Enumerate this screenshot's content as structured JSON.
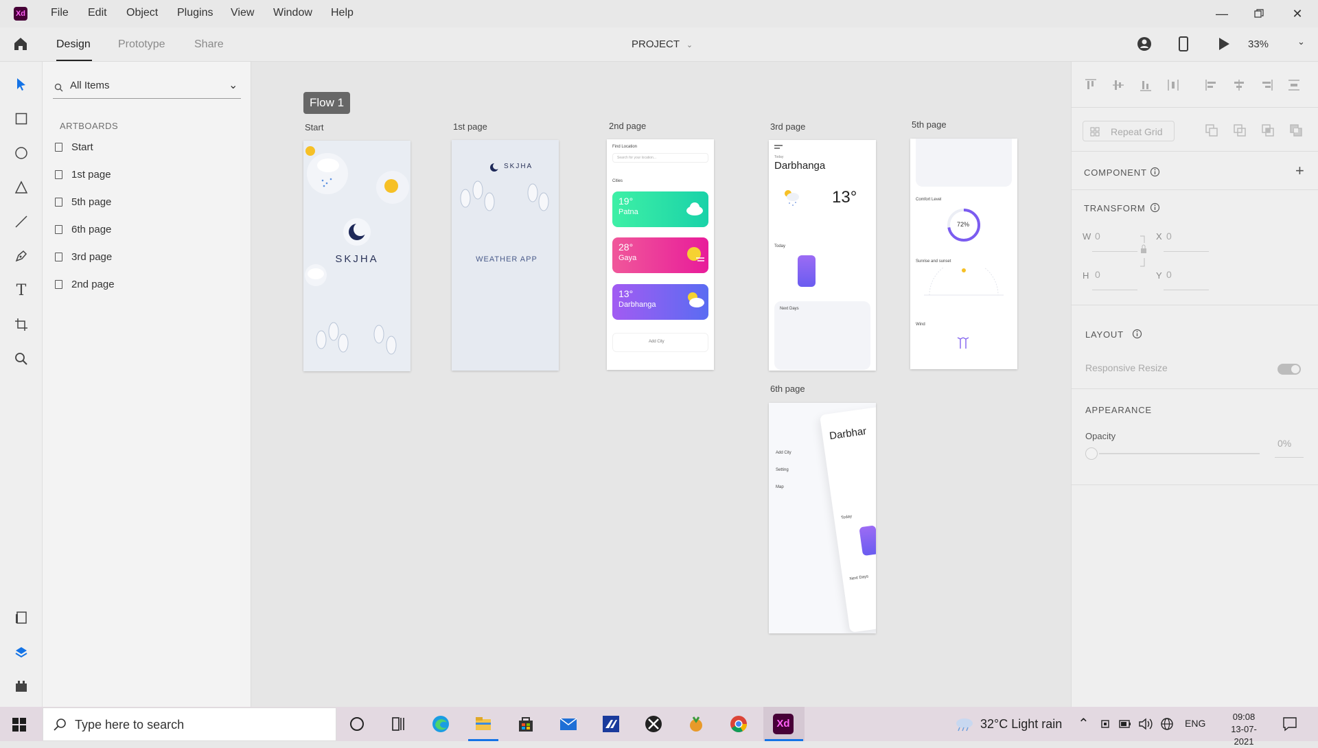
{
  "app": {
    "logo_text": "Xd"
  },
  "menu": [
    "File",
    "Edit",
    "Object",
    "Plugins",
    "View",
    "Window",
    "Help"
  ],
  "modes": {
    "tabs": [
      "Design",
      "Prototype",
      "Share"
    ],
    "active": "Design"
  },
  "document": {
    "title": "PROJECT",
    "zoom": "33%"
  },
  "layers_panel": {
    "search_label": "All Items",
    "section_heading": "ARTBOARDS",
    "items": [
      "Start",
      "1st page",
      "5th page",
      "6th page",
      "3rd page",
      "2nd page"
    ]
  },
  "canvas": {
    "flow_label": "Flow 1",
    "artboard_titles": [
      "Start",
      "1st page",
      "2nd page",
      "3rd page",
      "5th page",
      "6th page"
    ],
    "start": {
      "brand": "SKJHA"
    },
    "page1": {
      "brand": "SKJHA",
      "subtitle": "WEATHER APP"
    },
    "page2": {
      "heading": "Find Location",
      "search_placeholder": "Search for your location...",
      "section": "Cities",
      "cards": [
        {
          "temp": "19°",
          "city": "Patna"
        },
        {
          "temp": "28°",
          "city": "Gaya"
        },
        {
          "temp": "13°",
          "city": "Darbhanga"
        }
      ],
      "add_label": "Add City"
    },
    "page3": {
      "day": "Today",
      "city": "Darbhanga",
      "temp": "13°",
      "today_label": "Today",
      "next_label": "Next Days"
    },
    "page5": {
      "comfort": "Comfort Level",
      "humidity": "72%",
      "sun": "Sunrise and sunset",
      "wind": "Wind"
    },
    "page6": {
      "menu": [
        "Add City",
        "Setting",
        "Map"
      ],
      "city": "Darbhar",
      "today_label": "Today",
      "next_label": "Next Days"
    }
  },
  "properties": {
    "repeat_grid": "Repeat Grid",
    "component_heading": "COMPONENT",
    "transform_heading": "TRANSFORM",
    "w_label": "W",
    "w_value": "0",
    "x_label": "X",
    "x_value": "0",
    "h_label": "H",
    "h_value": "0",
    "y_label": "Y",
    "y_value": "0",
    "layout_heading": "LAYOUT",
    "responsive_label": "Responsive Resize",
    "appearance_heading": "APPEARANCE",
    "opacity_label": "Opacity",
    "opacity_value": "0%"
  },
  "taskbar": {
    "search_placeholder": "Type here to search",
    "weather": "32°C  Light rain",
    "language": "ENG",
    "time": "09:08",
    "date": "13-07-2021"
  },
  "colors": {
    "xd_purple": "#470137",
    "xd_pink": "#ff61f6",
    "patna_card": "#2ee8a0",
    "gaya_card": "#f0389a",
    "darbhanga_card": "#9c4cf0",
    "accent_blue": "#1473e6"
  }
}
